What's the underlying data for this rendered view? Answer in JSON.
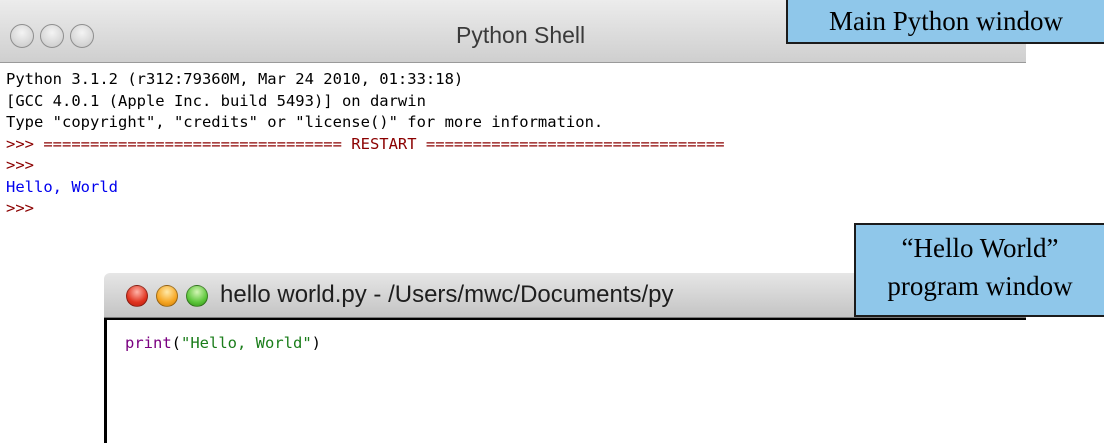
{
  "shell_window": {
    "title": "Python Shell",
    "lines": [
      {
        "type": "info",
        "text": "Python 3.1.2 (r312:79360M, Mar 24 2010, 01:33:18)"
      },
      {
        "type": "info",
        "text": "[GCC 4.0.1 (Apple Inc. build 5493)] on darwin"
      },
      {
        "type": "info",
        "text": "Type \"copyright\", \"credits\" or \"license()\" for more information."
      },
      {
        "type": "prompt",
        "text": ">>> ================================ RESTART ================================"
      },
      {
        "type": "prompt",
        "text": ">>>"
      },
      {
        "type": "stdout",
        "text": "Hello, World"
      },
      {
        "type": "prompt",
        "text": ">>>"
      }
    ]
  },
  "editor_window": {
    "title": "hello world.py - /Users/mwc/Documents/py",
    "code": {
      "keyword": "print",
      "open": "(",
      "string": "\"Hello, World\"",
      "close": ")"
    }
  },
  "annotations": {
    "main_window": "Main Python window",
    "hello_line1": "“Hello World”",
    "hello_line2": "program window"
  },
  "colors": {
    "prompt": "#8b0000",
    "stdout": "#0000ee",
    "keyword": "#7a0080",
    "string": "#1a7d1a",
    "callout": "#8fc7ea"
  }
}
